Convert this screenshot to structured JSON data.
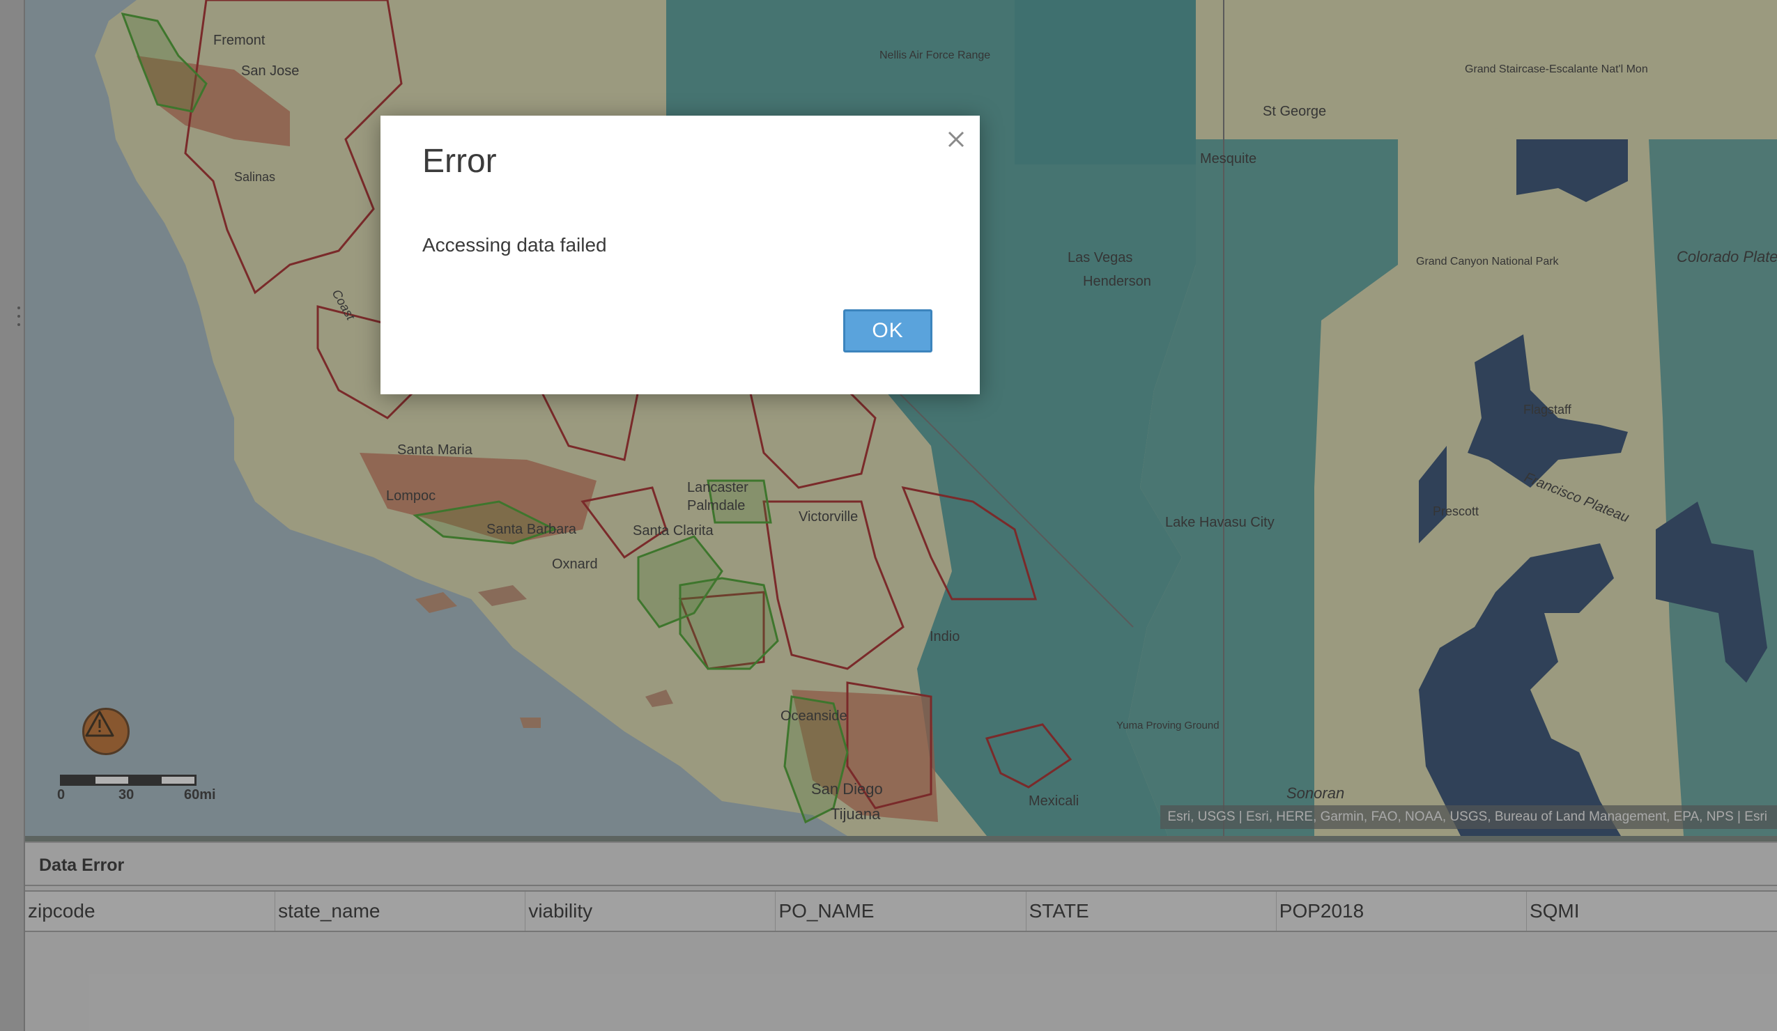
{
  "map": {
    "place_labels": [
      "Fremont",
      "San Jose",
      "Salinas",
      "Nellis Air Force Range",
      "St George",
      "Mesquite",
      "Grand Staircase-Escalante Nat'l Mon",
      "Las Vegas",
      "Henderson",
      "Grand Canyon National Park",
      "Colorado Plateau",
      "Santa Maria",
      "Lompoc",
      "Santa Barbara",
      "Lancaster",
      "Palmdale",
      "Santa Clarita",
      "Victorville",
      "Lake Havasu City",
      "Oxnard",
      "Indio",
      "Oceanside",
      "San Diego",
      "Tijuana",
      "Mexicali",
      "Yuma Proving Ground",
      "Sonoran",
      "Prescott",
      "Flagstaff",
      "Francisco Plateau",
      "Coast"
    ],
    "scale": {
      "labels": [
        "0",
        "30",
        "60mi"
      ]
    },
    "attribution": "Esri, USGS | Esri, HERE, Garmin, FAO, NOAA, USGS, Bureau of Land Management, EPA, NPS | Esri",
    "colors": {
      "ocean": "#8fa9b6",
      "land": "#cfcfa6",
      "teal": "#3a8c8c",
      "navy": "#1f4d7a",
      "red_outline": "#a01818",
      "green_outline": "#3a9a1c",
      "brown_fill": "#c16a4a"
    }
  },
  "panel": {
    "title": "Data Error",
    "columns": [
      "zipcode",
      "state_name",
      "viability",
      "PO_NAME",
      "STATE",
      "POP2018",
      "SQMI"
    ]
  },
  "dialog": {
    "title": "Error",
    "message": "Accessing data failed",
    "ok_label": "OK",
    "close_icon": "close-icon"
  },
  "icons": {
    "warning": "warning-icon",
    "rail_handle": "drag-handle-icon"
  }
}
